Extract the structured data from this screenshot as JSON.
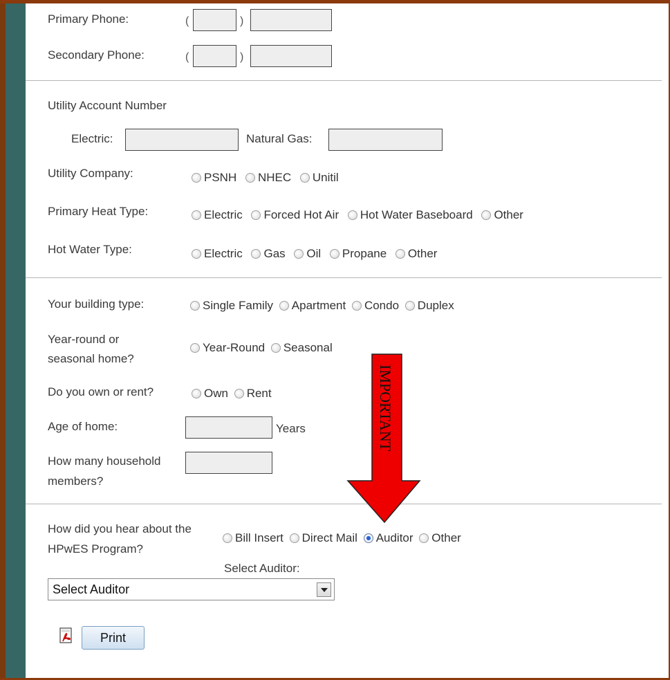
{
  "phone": {
    "primary_label": "Primary Phone:",
    "secondary_label": "Secondary Phone:",
    "paren_open": "(",
    "paren_close": ")"
  },
  "utility": {
    "account_heading": "Utility Account Number",
    "electric_label": "Electric:",
    "gas_label": "Natural Gas:",
    "company_label": "Utility Company:",
    "company_options": [
      "PSNH",
      "NHEC",
      "Unitil"
    ],
    "heat_label": "Primary Heat Type:",
    "heat_options": [
      "Electric",
      "Forced Hot Air",
      "Hot Water Baseboard",
      "Other"
    ],
    "water_label": "Hot Water Type:",
    "water_options": [
      "Electric",
      "Gas",
      "Oil",
      "Propane",
      "Other"
    ]
  },
  "home": {
    "building_label": "Your building type:",
    "building_options": [
      "Single Family",
      "Apartment",
      "Condo",
      "Duplex"
    ],
    "season_label_1": "Year-round or",
    "season_label_2": "seasonal home?",
    "season_options": [
      "Year-Round",
      "Seasonal"
    ],
    "own_label": "Do you own or rent?",
    "own_options": [
      "Own",
      "Rent"
    ],
    "age_label": "Age of home:",
    "age_unit": "Years",
    "members_label_1": "How many household",
    "members_label_2": "members?"
  },
  "referral": {
    "label_1": "How did you hear about the",
    "label_2": "HPwES Program?",
    "options": [
      "Bill Insert",
      "Direct Mail",
      "Auditor",
      "Other"
    ],
    "selected": "Auditor",
    "auditor_label": "Select Auditor:",
    "auditor_value": "Select Auditor"
  },
  "annotation": {
    "text": "IMPORTANT",
    "color": "#ee0000"
  },
  "actions": {
    "print_label": "Print",
    "pdf_icon": "pdf-icon"
  },
  "colors": {
    "sidebar": "#366765",
    "frame": "#8a3a0c",
    "arrow": "#ee0000"
  }
}
